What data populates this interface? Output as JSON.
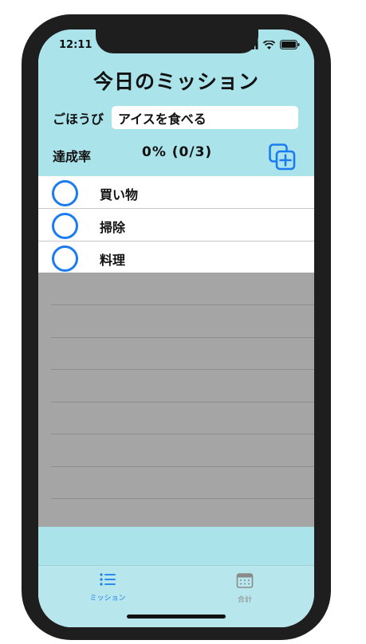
{
  "status_bar": {
    "time": "12:11"
  },
  "header": {
    "title": "今日のミッション",
    "reward_label": "ごほうび",
    "reward_value": "アイスを食べる",
    "rate_label": "達成率",
    "rate_value": "0% (0/3)"
  },
  "missions": [
    {
      "label": "買い物",
      "done": false
    },
    {
      "label": "掃除",
      "done": false
    },
    {
      "label": "料理",
      "done": false
    }
  ],
  "tab_bar": {
    "tabs": [
      {
        "label": "ミッション",
        "icon": "list-icon",
        "active": true
      },
      {
        "label": "合計",
        "icon": "calendar-icon",
        "active": false
      }
    ]
  },
  "colors": {
    "header_bg": "#abe3ea",
    "accent": "#1b7cf0",
    "empty_area": "#a5a5a5",
    "tab_inactive": "#8a8a8a"
  }
}
